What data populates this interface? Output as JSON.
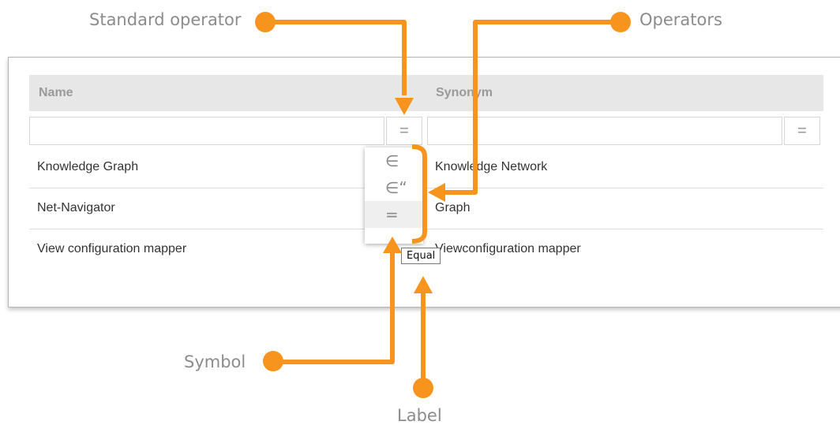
{
  "annotations": {
    "standard_operator": "Standard operator",
    "operators": "Operators",
    "symbol": "Symbol",
    "label": "Label"
  },
  "grid": {
    "columns": [
      "Name",
      "Synonym"
    ],
    "filters": [
      {
        "value": "",
        "operator": "="
      },
      {
        "value": "",
        "operator": "="
      }
    ],
    "rows": [
      [
        "Knowledge Graph",
        "Knowledge Network"
      ],
      [
        "Net-Navigator",
        "Graph"
      ],
      [
        "View configuration mapper",
        "Viewconfiguration mapper"
      ]
    ]
  },
  "operator_menu": {
    "items": [
      "∈",
      "∈“",
      "="
    ],
    "selected_index": 2,
    "tooltip": "Equal"
  },
  "colors": {
    "annotation": "#f7941d",
    "label_text": "#8c8c8c"
  }
}
